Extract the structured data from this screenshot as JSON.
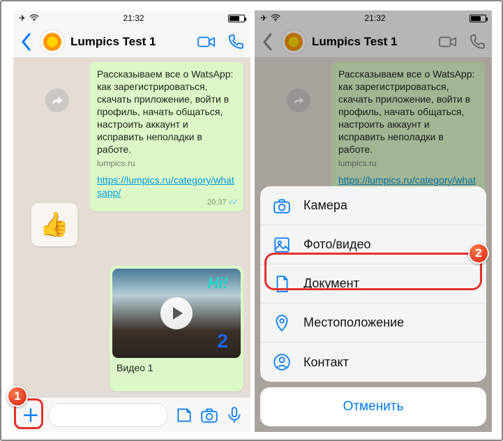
{
  "statusbar": {
    "time": "21:32"
  },
  "header": {
    "chat_name": "Lumpics Test 1"
  },
  "messages": {
    "msg1_text": "Рассказываем все о WatsApp: как зарегистрироваться, скачать приложение, войти в профиль, начать общаться, настроить аккаунт и исправить неполадки в работе.",
    "msg1_source": "lumpics.ru",
    "msg1_link": "https://lumpics.ru/category/whatsapp/",
    "msg1_time": "20:37",
    "sticker_emoji": "👍",
    "video_hi": "Hi!",
    "video_z": "2",
    "video_caption": "Видео 1"
  },
  "actionsheet": {
    "camera": "Камера",
    "photo_video": "Фото/видео",
    "document": "Документ",
    "location": "Местоположение",
    "contact": "Контакт",
    "cancel": "Отменить"
  },
  "annotations": {
    "badge1": "1",
    "badge2": "2"
  }
}
